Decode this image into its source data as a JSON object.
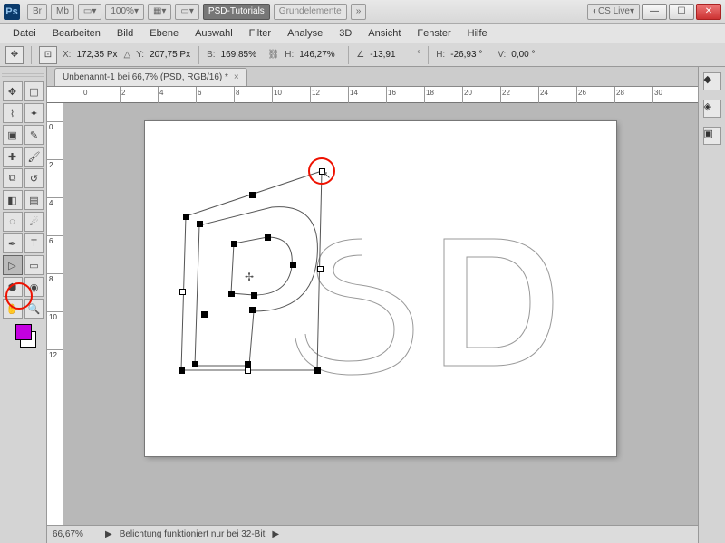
{
  "titlebar": {
    "br": "Br",
    "mb": "Mb",
    "zoom": "100%",
    "psd_tut": "PSD-Tutorials",
    "grund": "Grundelemente",
    "cslive": "CS Live"
  },
  "menu": [
    "Datei",
    "Bearbeiten",
    "Bild",
    "Ebene",
    "Auswahl",
    "Filter",
    "Analyse",
    "3D",
    "Ansicht",
    "Fenster",
    "Hilfe"
  ],
  "opt": {
    "x_lbl": "X:",
    "x": "172,35 Px",
    "y_lbl": "Y:",
    "y": "207,75 Px",
    "b_lbl": "B:",
    "b": "169,85%",
    "h_lbl": "H:",
    "h": "146,27%",
    "ang": "-13,91",
    "h2_lbl": "H:",
    "h2": "-26,93 °",
    "v_lbl": "V:",
    "v": "0,00   °"
  },
  "doc": {
    "tab": "Unbenannt-1 bei 66,7% (PSD, RGB/16) *"
  },
  "ruler_h": [
    "0",
    "2",
    "4",
    "6",
    "8",
    "10",
    "12",
    "14",
    "16",
    "18",
    "20",
    "22",
    "24",
    "26",
    "28",
    "30"
  ],
  "ruler_v": [
    "0",
    "2",
    "4",
    "6",
    "8",
    "10",
    "12"
  ],
  "status": {
    "pct": "66,67%",
    "msg": "Belichtung funktioniert nur bei 32-Bit"
  },
  "colors": {
    "fg": "#c400e0",
    "bg": "#ffffff"
  }
}
